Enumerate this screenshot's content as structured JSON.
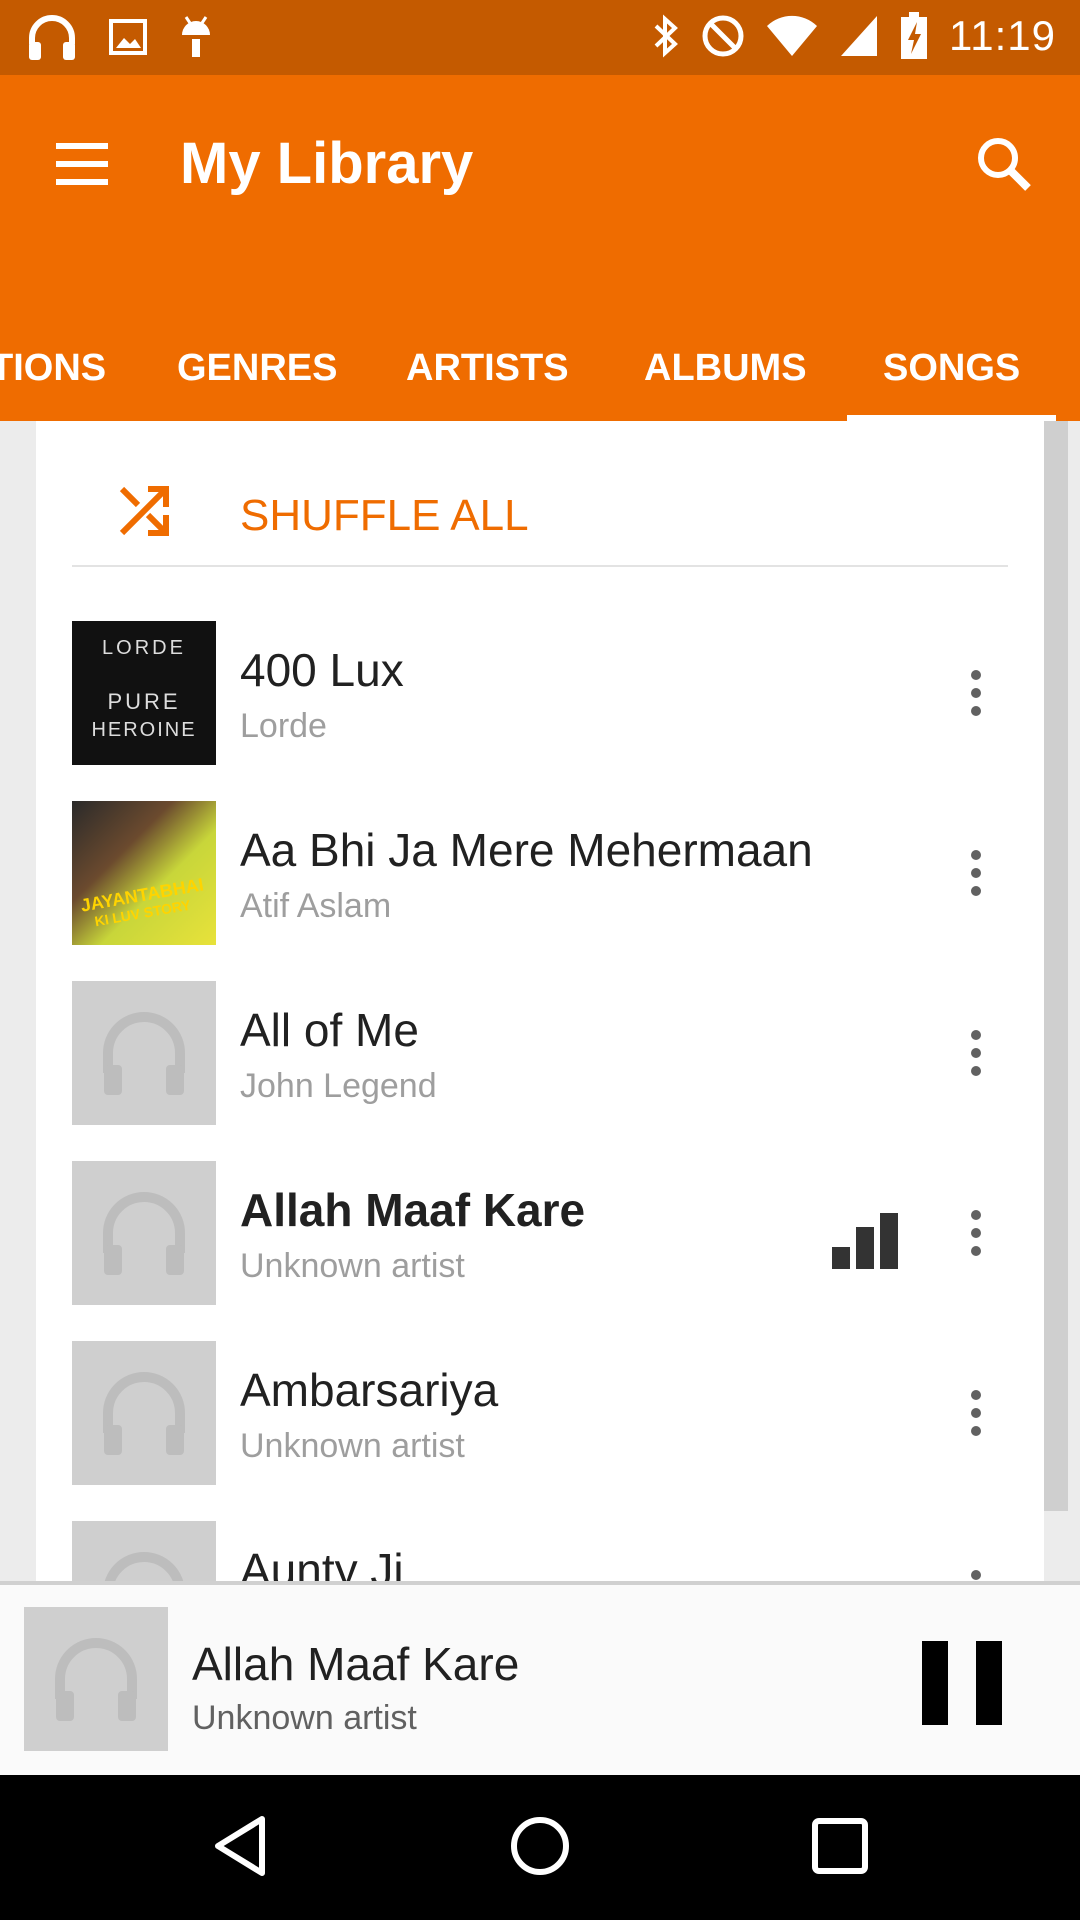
{
  "status_bar": {
    "time": "11:19",
    "left_icons": [
      "headphones-icon",
      "image-icon",
      "android-icon"
    ],
    "right_icons": [
      "bluetooth-icon",
      "do-not-disturb-icon",
      "wifi-icon",
      "cell-signal-icon",
      "battery-charging-icon"
    ]
  },
  "appbar": {
    "title": "My Library",
    "color": "#ef6c00"
  },
  "tabs": [
    {
      "label": "TIONS"
    },
    {
      "label": "GENRES"
    },
    {
      "label": "ARTISTS"
    },
    {
      "label": "ALBUMS"
    },
    {
      "label": "SONGS",
      "active": true
    }
  ],
  "shuffle": {
    "label": "SHUFFLE ALL"
  },
  "songs": [
    {
      "title": "400 Lux",
      "artist": "Lorde",
      "art": "album-cover",
      "art_text": [
        "LORDE",
        "PURE",
        "HEROINE"
      ]
    },
    {
      "title": "Aa Bhi Ja Mere Mehermaan",
      "artist": "Atif Aslam",
      "art": "album-cover-color",
      "art_text": [
        "JAYANTABHAI",
        "KI LUV STORY"
      ]
    },
    {
      "title": "All of Me",
      "artist": "John Legend",
      "art": "placeholder"
    },
    {
      "title": "Allah Maaf Kare",
      "artist": "Unknown artist",
      "art": "placeholder",
      "now_playing": true
    },
    {
      "title": "Ambarsariya",
      "artist": "Unknown artist",
      "art": "placeholder"
    },
    {
      "title": "Aunty Ji",
      "artist": "",
      "art": "placeholder"
    }
  ],
  "now_playing": {
    "title": "Allah Maaf Kare",
    "artist": "Unknown artist"
  },
  "nav": [
    "back-icon",
    "home-icon",
    "recents-icon"
  ]
}
